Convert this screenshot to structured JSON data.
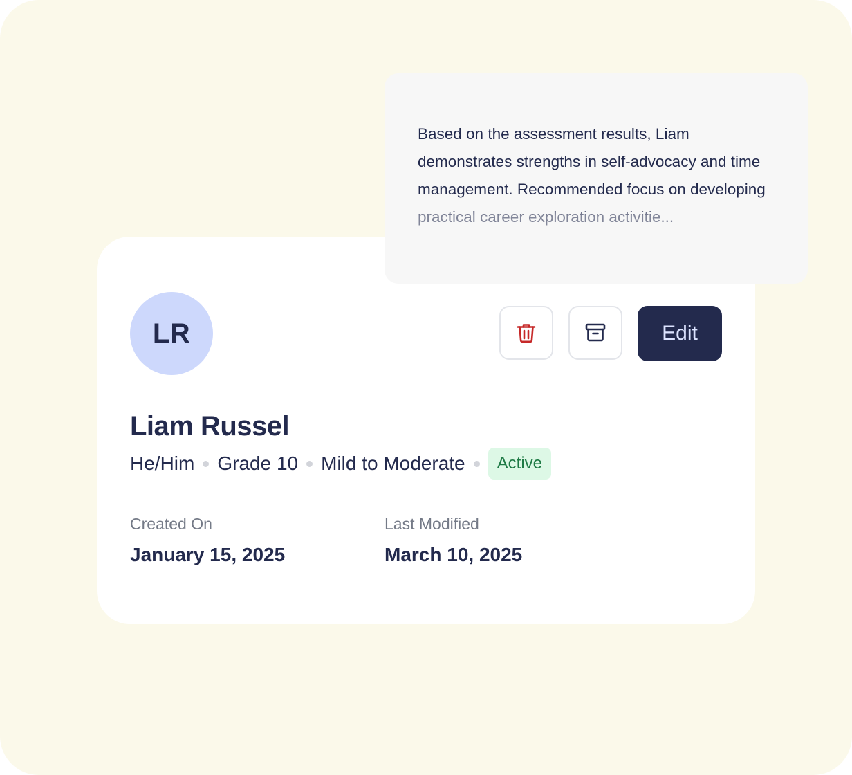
{
  "profile": {
    "initials": "LR",
    "name": "Liam Russel",
    "pronouns": "He/Him",
    "grade": "Grade 10",
    "support_level": "Mild to Moderate",
    "status": "Active"
  },
  "actions": {
    "delete_icon": "trash-icon",
    "archive_icon": "archive-icon",
    "edit_label": "Edit"
  },
  "dates": {
    "created_label": "Created On",
    "created_value": "January 15, 2025",
    "modified_label": "Last Modified",
    "modified_value": "March 10, 2025"
  },
  "summary": {
    "text": "Based on the assessment results, Liam demonstrates strengths in self-advocacy and time management. Recommended focus on developing practical career exploration activitie..."
  },
  "colors": {
    "background": "#FBF9EA",
    "primary": "#232A4D",
    "avatar_bg": "#CDD8FC",
    "delete_red": "#C62828",
    "status_green": "#1E7A45",
    "status_bg": "#DDF8E6"
  }
}
